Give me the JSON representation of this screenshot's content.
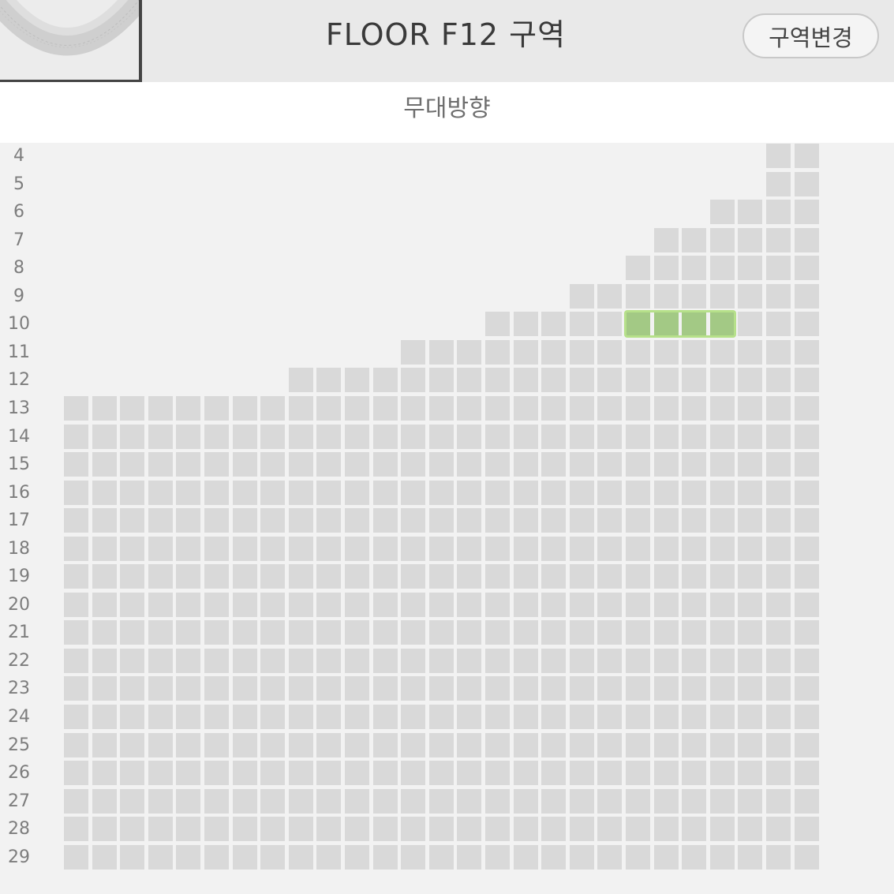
{
  "header": {
    "title": "FLOOR F12 구역",
    "change_button_label": "구역변경",
    "minimap_icon": "venue-map-icon"
  },
  "stage": {
    "label": "무대방향"
  },
  "seat_map": {
    "rows": [
      "4",
      "5",
      "6",
      "7",
      "8",
      "9",
      "10",
      "11",
      "12",
      "13",
      "14",
      "15",
      "16",
      "17",
      "18",
      "19",
      "20",
      "21",
      "22",
      "23",
      "24",
      "25",
      "26",
      "27",
      "28",
      "29"
    ],
    "total_columns": 27,
    "row_start_column": [
      25,
      25,
      23,
      21,
      20,
      18,
      15,
      12,
      8,
      0,
      0,
      0,
      0,
      0,
      0,
      0,
      0,
      0,
      0,
      0,
      0,
      0,
      0,
      0,
      0,
      0
    ],
    "selected": {
      "row": "10",
      "columns": [
        20,
        21,
        22,
        23
      ]
    },
    "colors": {
      "seat": "#d9d9d9",
      "selected_seat": "#a3c985",
      "selected_outline": "#b6e08a"
    }
  }
}
